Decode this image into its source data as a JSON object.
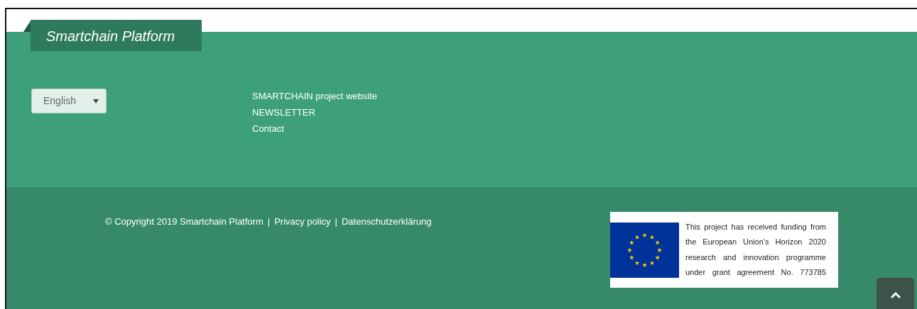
{
  "site_title": "Smartchain Platform",
  "language_select": {
    "value": "English"
  },
  "footer_links": [
    {
      "label": "SMARTCHAIN project website"
    },
    {
      "label": "NEWSLETTER"
    },
    {
      "label": "Contact"
    }
  ],
  "bottom_bar": {
    "copyright": "© Copyright 2019 Smartchain Platform",
    "links": [
      {
        "label": "Privacy policy"
      },
      {
        "label": "Datenschutzerklärung"
      }
    ],
    "separator": "|"
  },
  "funding_notice": {
    "lines": [
      "This project has received funding from",
      "the European Union’s Horizon 2020",
      "research and innovation programme",
      "under grant agreement  No. 773785"
    ]
  }
}
